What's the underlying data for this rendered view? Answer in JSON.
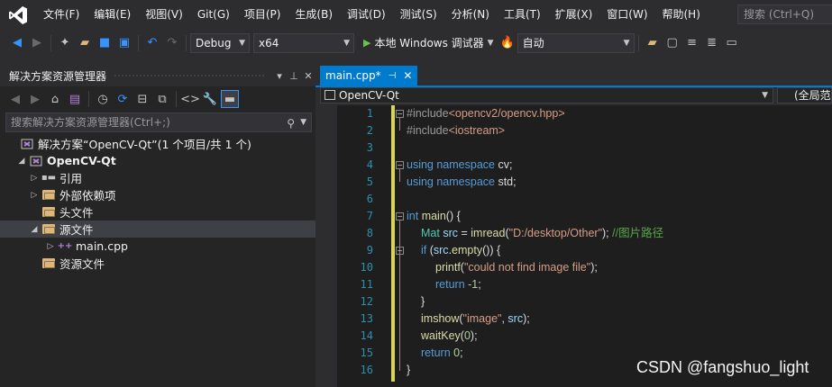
{
  "menu": [
    "文件(F)",
    "编辑(E)",
    "视图(V)",
    "Git(G)",
    "项目(P)",
    "生成(B)",
    "调试(D)",
    "测试(S)",
    "分析(N)",
    "工具(T)",
    "扩展(X)",
    "窗口(W)",
    "帮助(H)"
  ],
  "search_placeholder": "搜索 (Ctrl+Q)",
  "toolbar": {
    "config": "Debug",
    "platform": "x64",
    "run_label": "本地 Windows 调试器",
    "mode": "自动"
  },
  "solution_explorer": {
    "title": "解决方案资源管理器",
    "search_placeholder": "搜索解决方案资源管理器(Ctrl+;)",
    "tree": [
      {
        "label": "解决方案“OpenCV-Qt”(1 个项目/共 1 个)"
      },
      {
        "label": "OpenCV-Qt"
      },
      {
        "label": "引用"
      },
      {
        "label": "外部依赖项"
      },
      {
        "label": "头文件"
      },
      {
        "label": "源文件"
      },
      {
        "label": "main.cpp"
      },
      {
        "label": "资源文件"
      }
    ]
  },
  "editor": {
    "tab": "main.cpp*",
    "nav_file": "OpenCV-Qt",
    "nav_scope": "(全局范围)",
    "line_numbers": [
      "1",
      "2",
      "3",
      "4",
      "5",
      "6",
      "7",
      "8",
      "9",
      "10",
      "11",
      "12",
      "13",
      "14",
      "15",
      "16"
    ]
  },
  "watermark": "CSDN @fangshuo_light"
}
